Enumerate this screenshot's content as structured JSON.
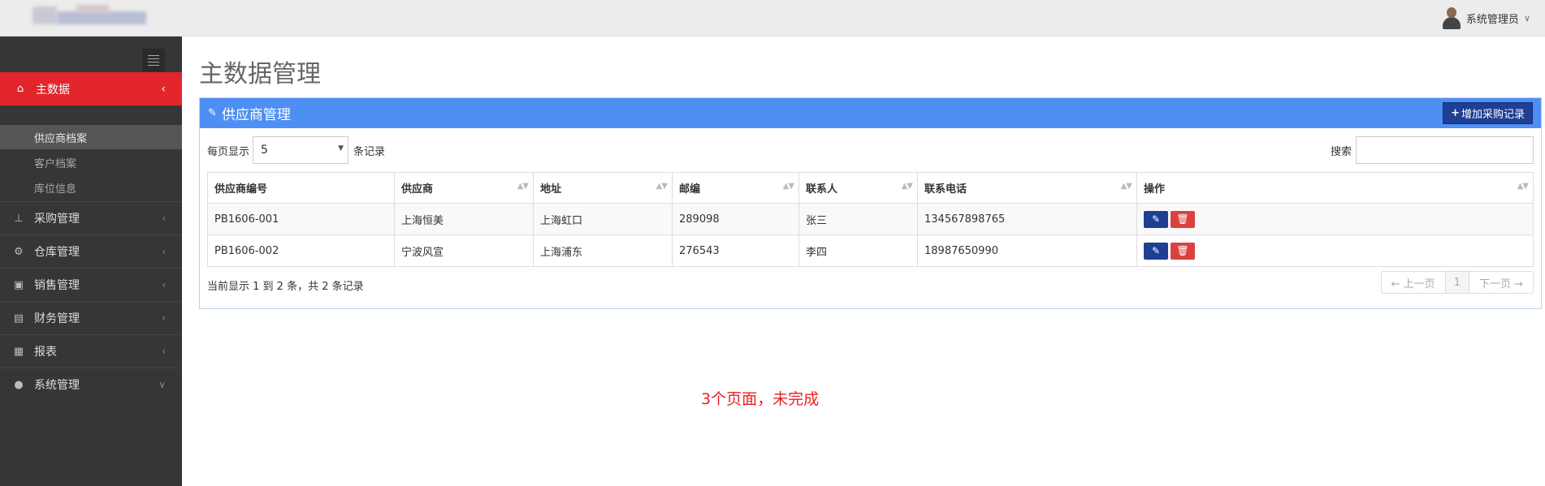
{
  "header": {
    "user_name": "系统管理员"
  },
  "sidebar": {
    "active_item": {
      "label": "主数据",
      "icon": "home-icon"
    },
    "sub_items": [
      {
        "label": "供应商档案"
      },
      {
        "label": "客户档案"
      },
      {
        "label": "库位信息"
      }
    ],
    "items": [
      {
        "label": "采购管理",
        "icon": "sitemap-icon"
      },
      {
        "label": "仓库管理",
        "icon": "cogs-icon"
      },
      {
        "label": "销售管理",
        "icon": "briefcase-icon"
      },
      {
        "label": "财务管理",
        "icon": "file-icon"
      },
      {
        "label": "报表",
        "icon": "table-icon"
      },
      {
        "label": "系统管理",
        "icon": "user-icon"
      }
    ]
  },
  "page": {
    "title": "主数据管理",
    "panel_title": "供应商管理",
    "add_button": "增加采购记录",
    "length_prefix": "每页显示",
    "length_value": "5",
    "length_suffix": "条记录",
    "search_label": "搜索",
    "search_value": ""
  },
  "table": {
    "columns": [
      "供应商编号",
      "供应商",
      "地址",
      "邮编",
      "联系人",
      "联系电话",
      "操作"
    ],
    "rows": [
      [
        "PB1606-001",
        "上海恒美",
        "上海虹口",
        "289098",
        "张三",
        "134567898765"
      ],
      [
        "PB1606-002",
        "宁波风宣",
        "上海浦东",
        "276543",
        "李四",
        "18987650990"
      ]
    ]
  },
  "footer": {
    "info": "当前显示 1 到 2 条，共 2 条记录",
    "prev": "← 上一页",
    "page": "1",
    "next": "下一页 →"
  },
  "note": "3个页面，未完成",
  "colors": {
    "accent_red": "#e2262b",
    "panel_blue": "#4e8ff3",
    "button_navy": "#1f3f93",
    "delete_red": "#d9423e",
    "sidebar_bg": "#363636",
    "note_red": "#e8211d"
  }
}
